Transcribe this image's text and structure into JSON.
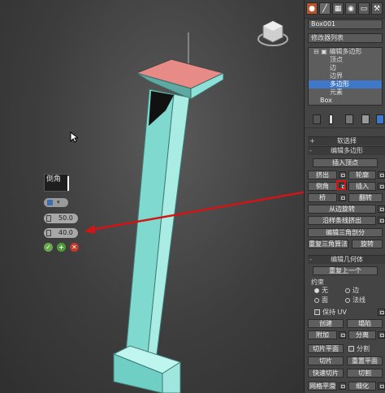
{
  "colors": {
    "accent_selection": "#3f78c8",
    "arrow_red": "#d41414",
    "column_cyan": "#7fd9cf",
    "cap_pink": "#e88a86"
  },
  "viewport": {
    "viewcube_icon": "viewcube-icon",
    "caddy": {
      "title": "倒角",
      "type_icon": "group-type-icon",
      "height_value": "50.0",
      "outline_value": "40.0",
      "ok_icon": "check-icon",
      "apply_icon": "plus-icon",
      "cancel_icon": "close-icon"
    }
  },
  "panel": {
    "tabs": [
      "create-icon",
      "modify-icon",
      "hierarchy-icon",
      "motion-icon",
      "display-icon",
      "utilities-icon"
    ],
    "object_name": "Box001",
    "modifier_list": "修改器列表",
    "stack": {
      "root": "编辑多边形",
      "items": [
        "顶点",
        "边",
        "边界",
        "多边形",
        "元素"
      ],
      "selected": "多边形",
      "base": "Box"
    },
    "rollouts": {
      "soft_selection": "软选择",
      "edit_polygons": "编辑多边形",
      "edit_geometry": "编辑几何体"
    },
    "edit_polygons": {
      "insert_vertex": "插入顶点",
      "extrude": "挤出",
      "outline": "轮廓",
      "bevel": "倒角",
      "inset": "插入",
      "bridge": "桥",
      "flip": "翻转",
      "hinge": "从边旋转",
      "extrude_spline": "沿样条线挤出",
      "edit_triangulation": "编辑三角剖分",
      "retriangulate": "重复三角算法",
      "turn": "旋转"
    },
    "edit_geometry": {
      "repeat_last": "重复上一个",
      "constraints": "约束",
      "c_none": "无",
      "c_edge": "边",
      "c_face": "面",
      "c_normal": "法线",
      "preserve_uv": "保持 UV",
      "create": "创建",
      "collapse": "塌陷",
      "attach": "附加",
      "detach": "分离",
      "slice_plane": "切片平面",
      "split": "分割",
      "slice": "切片",
      "reset_plane": "重置平面",
      "quickslice": "快速切片",
      "cut": "切割",
      "msmooth": "网格平滑",
      "tessellate": "细化"
    }
  }
}
